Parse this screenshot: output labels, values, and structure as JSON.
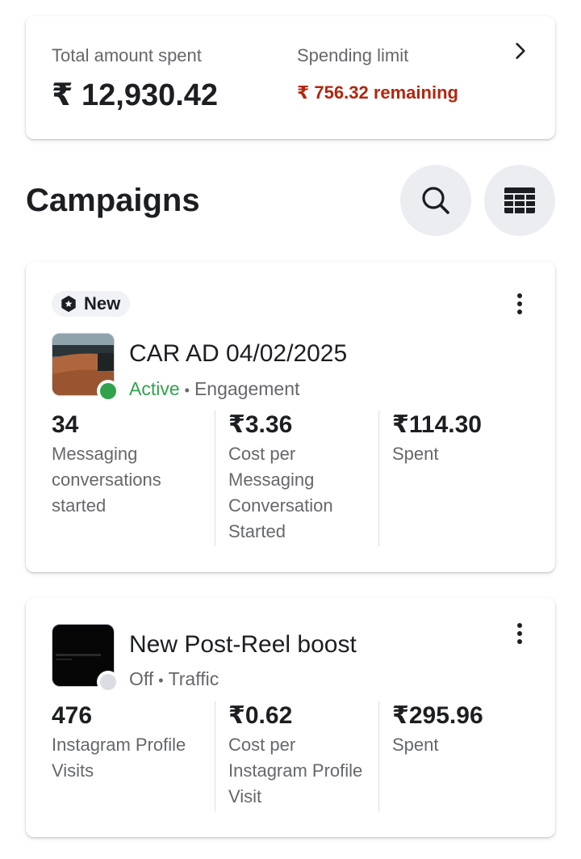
{
  "spend_summary": {
    "total_label": "Total amount spent",
    "total_amount": "₹ 12,930.42",
    "limit_label": "Spending limit",
    "limit_remaining": "₹ 756.32 remaining",
    "chevron_icon": "chevron-right-icon"
  },
  "campaigns_header": {
    "title": "Campaigns",
    "search_icon": "search-icon",
    "table_icon": "table-view-icon"
  },
  "campaigns": [
    {
      "badge": "New",
      "badge_icon": "hexagon-star-icon",
      "name": "CAR AD 04/02/2025",
      "status": "Active",
      "status_color": "#31a24c",
      "objective": "Engagement",
      "metrics": [
        {
          "value": "34",
          "label": "Messaging conversations started"
        },
        {
          "value": "₹3.36",
          "label": "Cost per Messaging Conversation Started"
        },
        {
          "value": "₹114.30",
          "label": "Spent"
        }
      ]
    },
    {
      "name": "New Post-Reel boost",
      "status": "Off",
      "status_color": "#dadde1",
      "objective": "Traffic",
      "metrics": [
        {
          "value": "476",
          "label": "Instagram Profile Visits"
        },
        {
          "value": "₹0.62",
          "label": "Cost per Instagram Profile Visit"
        },
        {
          "value": "₹295.96",
          "label": "Spent"
        }
      ]
    }
  ],
  "separator": "•"
}
